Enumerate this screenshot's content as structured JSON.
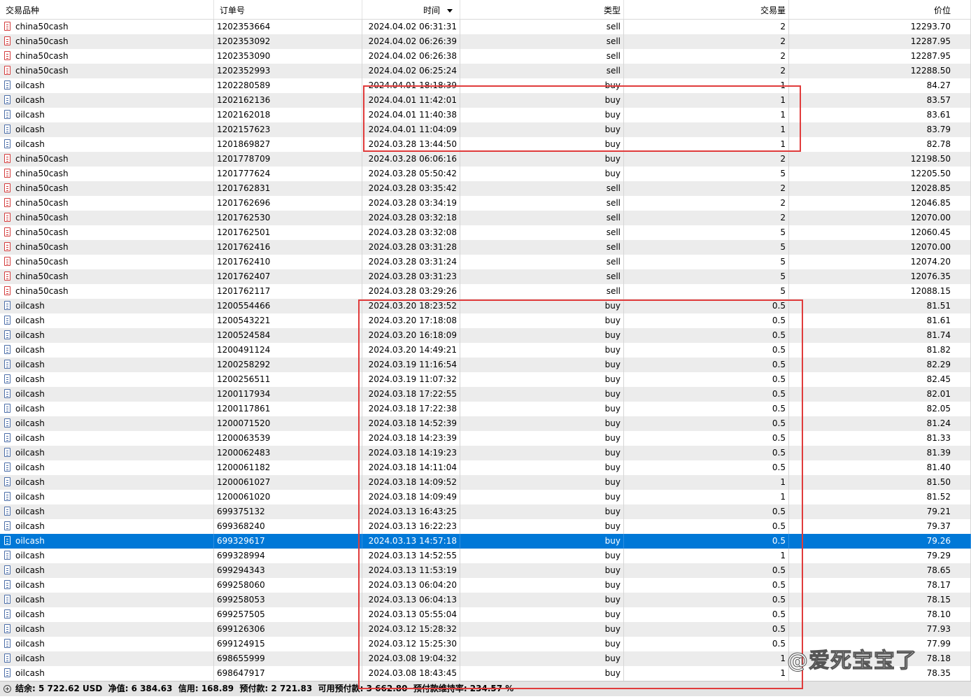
{
  "columns": [
    "交易品种",
    "订单号",
    "时间",
    "类型",
    "交易量",
    "价位"
  ],
  "rows": [
    {
      "symbol": "china50cash",
      "order": "1202353664",
      "time": "2024.04.02 06:31:31",
      "type": "sell",
      "volume": "2",
      "price": "12293.70"
    },
    {
      "symbol": "china50cash",
      "order": "1202353092",
      "time": "2024.04.02 06:26:39",
      "type": "sell",
      "volume": "2",
      "price": "12287.95"
    },
    {
      "symbol": "china50cash",
      "order": "1202353090",
      "time": "2024.04.02 06:26:38",
      "type": "sell",
      "volume": "2",
      "price": "12287.95"
    },
    {
      "symbol": "china50cash",
      "order": "1202352993",
      "time": "2024.04.02 06:25:24",
      "type": "sell",
      "volume": "2",
      "price": "12288.50"
    },
    {
      "symbol": "oilcash",
      "order": "1202280589",
      "time": "2024.04.01 18:18:39",
      "type": "buy",
      "volume": "1",
      "price": "84.27"
    },
    {
      "symbol": "oilcash",
      "order": "1202162136",
      "time": "2024.04.01 11:42:01",
      "type": "buy",
      "volume": "1",
      "price": "83.57"
    },
    {
      "symbol": "oilcash",
      "order": "1202162018",
      "time": "2024.04.01 11:40:38",
      "type": "buy",
      "volume": "1",
      "price": "83.61"
    },
    {
      "symbol": "oilcash",
      "order": "1202157623",
      "time": "2024.04.01 11:04:09",
      "type": "buy",
      "volume": "1",
      "price": "83.79"
    },
    {
      "symbol": "oilcash",
      "order": "1201869827",
      "time": "2024.03.28 13:44:50",
      "type": "buy",
      "volume": "1",
      "price": "82.78"
    },
    {
      "symbol": "china50cash",
      "order": "1201778709",
      "time": "2024.03.28 06:06:16",
      "type": "buy",
      "volume": "2",
      "price": "12198.50"
    },
    {
      "symbol": "china50cash",
      "order": "1201777624",
      "time": "2024.03.28 05:50:42",
      "type": "buy",
      "volume": "5",
      "price": "12205.50"
    },
    {
      "symbol": "china50cash",
      "order": "1201762831",
      "time": "2024.03.28 03:35:42",
      "type": "sell",
      "volume": "2",
      "price": "12028.85"
    },
    {
      "symbol": "china50cash",
      "order": "1201762696",
      "time": "2024.03.28 03:34:19",
      "type": "sell",
      "volume": "2",
      "price": "12046.85"
    },
    {
      "symbol": "china50cash",
      "order": "1201762530",
      "time": "2024.03.28 03:32:18",
      "type": "sell",
      "volume": "2",
      "price": "12070.00"
    },
    {
      "symbol": "china50cash",
      "order": "1201762501",
      "time": "2024.03.28 03:32:08",
      "type": "sell",
      "volume": "5",
      "price": "12060.45"
    },
    {
      "symbol": "china50cash",
      "order": "1201762416",
      "time": "2024.03.28 03:31:28",
      "type": "sell",
      "volume": "5",
      "price": "12070.00"
    },
    {
      "symbol": "china50cash",
      "order": "1201762410",
      "time": "2024.03.28 03:31:24",
      "type": "sell",
      "volume": "5",
      "price": "12074.20"
    },
    {
      "symbol": "china50cash",
      "order": "1201762407",
      "time": "2024.03.28 03:31:23",
      "type": "sell",
      "volume": "5",
      "price": "12076.35"
    },
    {
      "symbol": "china50cash",
      "order": "1201762117",
      "time": "2024.03.28 03:29:26",
      "type": "sell",
      "volume": "5",
      "price": "12088.15"
    },
    {
      "symbol": "oilcash",
      "order": "1200554466",
      "time": "2024.03.20 18:23:52",
      "type": "buy",
      "volume": "0.5",
      "price": "81.51"
    },
    {
      "symbol": "oilcash",
      "order": "1200543221",
      "time": "2024.03.20 17:18:08",
      "type": "buy",
      "volume": "0.5",
      "price": "81.61"
    },
    {
      "symbol": "oilcash",
      "order": "1200524584",
      "time": "2024.03.20 16:18:09",
      "type": "buy",
      "volume": "0.5",
      "price": "81.74"
    },
    {
      "symbol": "oilcash",
      "order": "1200491124",
      "time": "2024.03.20 14:49:21",
      "type": "buy",
      "volume": "0.5",
      "price": "81.82"
    },
    {
      "symbol": "oilcash",
      "order": "1200258292",
      "time": "2024.03.19 11:16:54",
      "type": "buy",
      "volume": "0.5",
      "price": "82.29"
    },
    {
      "symbol": "oilcash",
      "order": "1200256511",
      "time": "2024.03.19 11:07:32",
      "type": "buy",
      "volume": "0.5",
      "price": "82.45"
    },
    {
      "symbol": "oilcash",
      "order": "1200117934",
      "time": "2024.03.18 17:22:55",
      "type": "buy",
      "volume": "0.5",
      "price": "82.01"
    },
    {
      "symbol": "oilcash",
      "order": "1200117861",
      "time": "2024.03.18 17:22:38",
      "type": "buy",
      "volume": "0.5",
      "price": "82.05"
    },
    {
      "symbol": "oilcash",
      "order": "1200071520",
      "time": "2024.03.18 14:52:39",
      "type": "buy",
      "volume": "0.5",
      "price": "81.24"
    },
    {
      "symbol": "oilcash",
      "order": "1200063539",
      "time": "2024.03.18 14:23:39",
      "type": "buy",
      "volume": "0.5",
      "price": "81.33"
    },
    {
      "symbol": "oilcash",
      "order": "1200062483",
      "time": "2024.03.18 14:19:23",
      "type": "buy",
      "volume": "0.5",
      "price": "81.39"
    },
    {
      "symbol": "oilcash",
      "order": "1200061182",
      "time": "2024.03.18 14:11:04",
      "type": "buy",
      "volume": "0.5",
      "price": "81.40"
    },
    {
      "symbol": "oilcash",
      "order": "1200061027",
      "time": "2024.03.18 14:09:52",
      "type": "buy",
      "volume": "1",
      "price": "81.50"
    },
    {
      "symbol": "oilcash",
      "order": "1200061020",
      "time": "2024.03.18 14:09:49",
      "type": "buy",
      "volume": "1",
      "price": "81.52"
    },
    {
      "symbol": "oilcash",
      "order": "699375132",
      "time": "2024.03.13 16:43:25",
      "type": "buy",
      "volume": "0.5",
      "price": "79.21"
    },
    {
      "symbol": "oilcash",
      "order": "699368240",
      "time": "2024.03.13 16:22:23",
      "type": "buy",
      "volume": "0.5",
      "price": "79.37"
    },
    {
      "symbol": "oilcash",
      "order": "699329617",
      "time": "2024.03.13 14:57:18",
      "type": "buy",
      "volume": "0.5",
      "price": "79.26",
      "selected": true
    },
    {
      "symbol": "oilcash",
      "order": "699328994",
      "time": "2024.03.13 14:52:55",
      "type": "buy",
      "volume": "1",
      "price": "79.29"
    },
    {
      "symbol": "oilcash",
      "order": "699294343",
      "time": "2024.03.13 11:53:19",
      "type": "buy",
      "volume": "0.5",
      "price": "78.65"
    },
    {
      "symbol": "oilcash",
      "order": "699258060",
      "time": "2024.03.13 06:04:20",
      "type": "buy",
      "volume": "0.5",
      "price": "78.17"
    },
    {
      "symbol": "oilcash",
      "order": "699258053",
      "time": "2024.03.13 06:04:13",
      "type": "buy",
      "volume": "0.5",
      "price": "78.15"
    },
    {
      "symbol": "oilcash",
      "order": "699257505",
      "time": "2024.03.13 05:55:04",
      "type": "buy",
      "volume": "0.5",
      "price": "78.10"
    },
    {
      "symbol": "oilcash",
      "order": "699126306",
      "time": "2024.03.12 15:28:32",
      "type": "buy",
      "volume": "0.5",
      "price": "77.93"
    },
    {
      "symbol": "oilcash",
      "order": "699124915",
      "time": "2024.03.12 15:25:30",
      "type": "buy",
      "volume": "0.5",
      "price": "77.99"
    },
    {
      "symbol": "oilcash",
      "order": "698655999",
      "time": "2024.03.08 19:04:32",
      "type": "buy",
      "volume": "1",
      "price": "78.18"
    },
    {
      "symbol": "oilcash",
      "order": "698647917",
      "time": "2024.03.08 18:43:45",
      "type": "buy",
      "volume": "1",
      "price": "78.35"
    }
  ],
  "status_bar": "结余: 5 722.62 USD  净值: 6 384.63  信用: 168.89  预付款: 2 721.83  可用预付款: 3 662.80  预付款维持率: 234.57 %",
  "watermark": "@爱死宝宝了",
  "colors": {
    "selected_row": "#0078d7",
    "highlight_box": "#e03b3b",
    "sell_icon": "#d43c3c",
    "buy_icon": "#4c6ea8"
  }
}
